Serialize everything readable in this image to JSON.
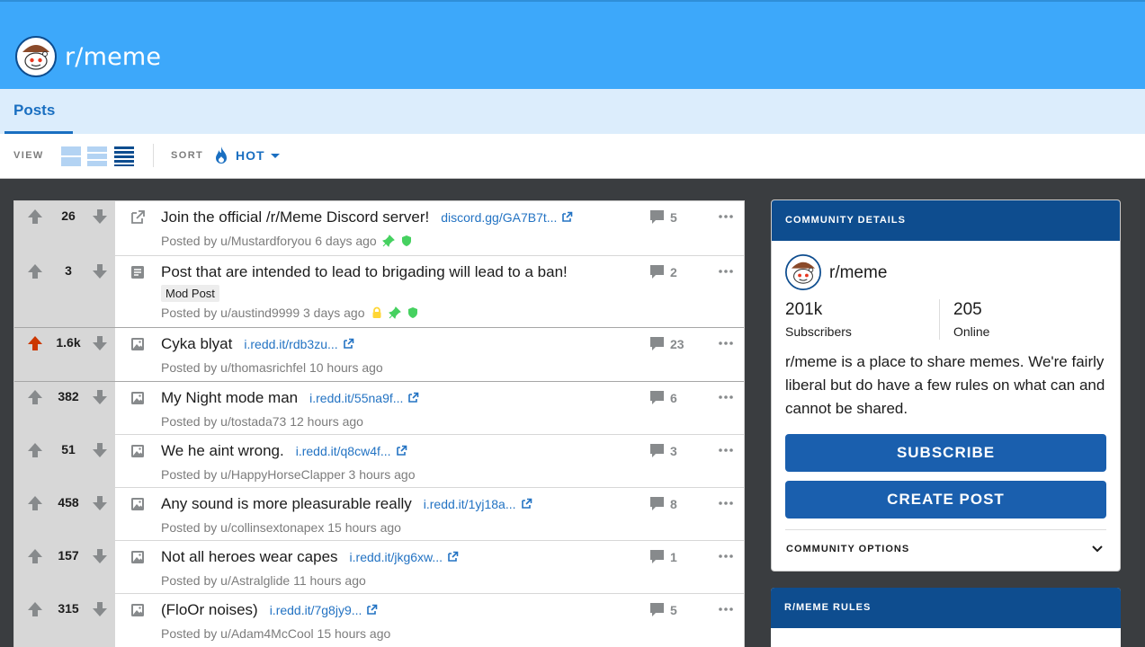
{
  "header": {
    "subreddit": "r/meme",
    "avatar_icon": "snoo-avatar-icon",
    "banner_color": "#3da8fa"
  },
  "tabs": [
    {
      "label": "Posts",
      "active": true
    }
  ],
  "toolbar": {
    "view_label": "VIEW",
    "view_options": [
      "card-view-icon",
      "classic-view-icon",
      "compact-view-icon"
    ],
    "selected_view": "compact",
    "sort_label": "SORT",
    "sort_value": "HOT",
    "sort_icon": "flame-icon"
  },
  "posts": [
    {
      "score": "26",
      "type": "link",
      "title": "Join the official /r/Meme Discord server!",
      "link": "discord.gg/GA7B7t...",
      "meta": "Posted by u/Mustardforyou 6 days ago",
      "badges": [
        "pin-icon",
        "shield-icon"
      ],
      "comments": "5",
      "upvoted": false
    },
    {
      "score": "3",
      "type": "text",
      "title": "Post that are intended to lead to brigading will lead to a ban!",
      "link": "",
      "flair": "Mod Post",
      "meta": "Posted by u/austind9999 3 days ago",
      "badges": [
        "lock-icon",
        "pin-icon",
        "shield-icon"
      ],
      "comments": "2",
      "upvoted": false
    },
    {
      "score": "1.6k",
      "type": "image",
      "title": "Cyka blyat",
      "link": "i.redd.it/rdb3zu...",
      "meta": "Posted by u/thomasrichfel 10 hours ago",
      "badges": [],
      "comments": "23",
      "upvoted": true
    },
    {
      "score": "382",
      "type": "image",
      "title": "My Night mode man",
      "link": "i.redd.it/55na9f...",
      "meta": "Posted by u/tostada73 12 hours ago",
      "badges": [],
      "comments": "6",
      "upvoted": false
    },
    {
      "score": "51",
      "type": "image",
      "title": "We he aint wrong.",
      "link": "i.redd.it/q8cw4f...",
      "meta": "Posted by u/HappyHorseClapper 3 hours ago",
      "badges": [],
      "comments": "3",
      "upvoted": false
    },
    {
      "score": "458",
      "type": "image",
      "title": "Any sound is more pleasurable really",
      "link": "i.redd.it/1yj18a...",
      "meta": "Posted by u/collinsextonapex 15 hours ago",
      "badges": [],
      "comments": "8",
      "upvoted": false
    },
    {
      "score": "157",
      "type": "image",
      "title": "Not all heroes wear capes",
      "link": "i.redd.it/jkg6xw...",
      "meta": "Posted by u/Astralglide 11 hours ago",
      "badges": [],
      "comments": "1",
      "upvoted": false
    },
    {
      "score": "315",
      "type": "image",
      "title": "(FloOr noises)",
      "link": "i.redd.it/7g8jy9...",
      "meta": "Posted by u/Adam4McCool 15 hours ago",
      "badges": [],
      "comments": "5",
      "upvoted": false
    }
  ],
  "community": {
    "header": "COMMUNITY DETAILS",
    "name": "r/meme",
    "subscribers_value": "201k",
    "subscribers_label": "Subscribers",
    "online_value": "205",
    "online_label": "Online",
    "description": "r/meme is a place to share memes. We're fairly liberal but do have a few rules on what can and cannot be shared.",
    "subscribe_label": "SUBSCRIBE",
    "create_post_label": "CREATE POST",
    "options_label": "COMMUNITY OPTIONS"
  },
  "rules": {
    "header": "R/MEME RULES"
  },
  "colors": {
    "accent": "#1a6fc1",
    "button": "#1a5fae",
    "card_header": "#0e4d8f",
    "upvote_active": "#cc3700"
  }
}
